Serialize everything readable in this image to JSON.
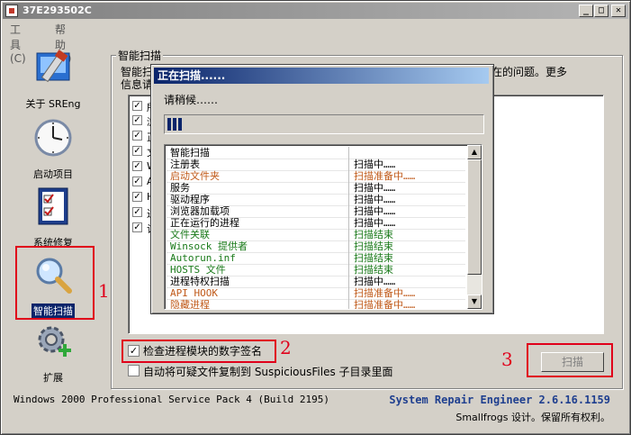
{
  "window": {
    "title": "37E293502C"
  },
  "titlebar_buttons": {
    "min": "_",
    "max": "□",
    "close": "✕"
  },
  "menu": [
    {
      "label": "工具(C)"
    },
    {
      "label": "帮助(H)"
    }
  ],
  "sidebar": [
    {
      "label": "关于 SREng",
      "icon": "tools-icon"
    },
    {
      "label": "启动项目",
      "icon": "clock-icon"
    },
    {
      "label": "系统修复",
      "icon": "checklist-icon"
    },
    {
      "label": "智能扫描",
      "icon": "magnifier-icon",
      "selected": true
    },
    {
      "label": "扩展",
      "icon": "gear-plus-icon"
    }
  ],
  "main": {
    "group_title": "智能扫描",
    "description_left": "智能扫",
    "description_right": "统中存在的问题。更多",
    "description_line2": "信息请",
    "checklist": [
      {
        "text": "所",
        "checked": true
      },
      {
        "text": "浏",
        "checked": true
      },
      {
        "text": "正",
        "checked": true
      },
      {
        "text": "文",
        "checked": true
      },
      {
        "text": "W",
        "checked": true
      },
      {
        "text": "A",
        "checked": true
      },
      {
        "text": "H",
        "checked": true
      },
      {
        "text": "进",
        "checked": true
      },
      {
        "text": "计",
        "checked": true
      }
    ],
    "option_signature": {
      "label": "检查进程模块的数字签名",
      "checked": true
    },
    "option_copy": {
      "label": "自动将可疑文件复制到 SuspiciousFiles 子目录里面",
      "checked": false
    },
    "scan_button": "扫描"
  },
  "dialog": {
    "title": "正在扫描......",
    "wait_text": "请稍候……",
    "progress_percent": 5,
    "rows": [
      {
        "name": "智能扫描",
        "status": "",
        "color": "#000000"
      },
      {
        "name": "注册表",
        "status": "扫描中……",
        "color": "#000000"
      },
      {
        "name": "启动文件夹",
        "status": "扫描准备中……",
        "color": "#c05a1a"
      },
      {
        "name": "服务",
        "status": "扫描中……",
        "color": "#000000"
      },
      {
        "name": "驱动程序",
        "status": "扫描中……",
        "color": "#000000"
      },
      {
        "name": "浏览器加载项",
        "status": "扫描中……",
        "color": "#000000"
      },
      {
        "name": "正在运行的进程",
        "status": "扫描中……",
        "color": "#000000"
      },
      {
        "name": "文件关联",
        "status": "扫描结束",
        "color": "#1a7a1a"
      },
      {
        "name": "Winsock 提供者",
        "status": "扫描结束",
        "color": "#1a7a1a"
      },
      {
        "name": "Autorun.inf",
        "status": "扫描结束",
        "color": "#1a7a1a"
      },
      {
        "name": "HOSTS 文件",
        "status": "扫描结束",
        "color": "#1a7a1a"
      },
      {
        "name": "进程特权扫描",
        "status": "扫描中……",
        "color": "#000000"
      },
      {
        "name": "API HOOK",
        "status": "扫描准备中……",
        "color": "#c05a1a"
      },
      {
        "name": "隐藏进程",
        "status": "扫描准备中……",
        "color": "#c05a1a"
      }
    ]
  },
  "annotations": {
    "one": "1",
    "two": "2",
    "three": "3",
    "color": "#e0001a"
  },
  "status": {
    "os": "Windows 2000 Professional Service Pack 4 (Build 2195)",
    "product": "System Repair Engineer 2.6.16.1159",
    "copyright": "Smallfrogs 设计。保留所有权利。"
  }
}
